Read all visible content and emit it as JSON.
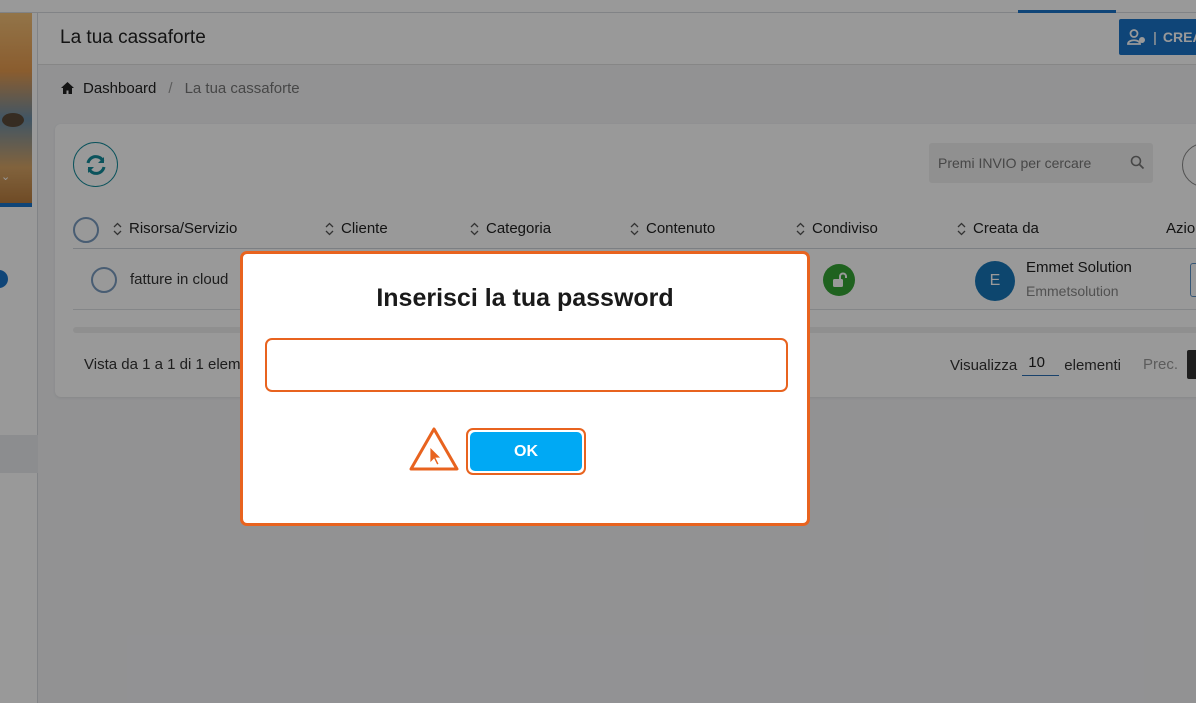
{
  "header": {
    "title": "La tua cassaforte",
    "create_button_label": "CREA"
  },
  "breadcrumb": {
    "home_label": "Dashboard",
    "current_label": "La tua cassaforte"
  },
  "search": {
    "placeholder": "Premi INVIO per cercare"
  },
  "table": {
    "columns": [
      "Risorsa/Servizio",
      "Cliente",
      "Categoria",
      "Contenuto",
      "Condiviso",
      "Creata da",
      "Azio"
    ],
    "rows": [
      {
        "resource": "fatture in cloud",
        "shared": true,
        "creator_initial": "E",
        "creator_name": "Emmet Solution",
        "creator_username": "Emmetsolution"
      }
    ]
  },
  "footer": {
    "info": "Vista da 1 a 1 di 1 elem",
    "show_label": "Visualizza",
    "page_size": "10",
    "elements_label": "elementi",
    "prev_label": "Prec."
  },
  "modal": {
    "title": "Inserisci la tua password",
    "password_value": "",
    "ok_label": "OK"
  },
  "colors": {
    "primary": "#1a73c9",
    "highlight": "#e8631f",
    "ok_button": "#00a9f4",
    "shared_badge": "#35a335",
    "avatar": "#1676b7"
  },
  "icons": {
    "home": "home-icon",
    "refresh": "refresh-icon",
    "search": "search-icon",
    "sort": "sort-icon",
    "unlock": "unlock-icon",
    "warning": "warning-icon",
    "add_user": "add-user-icon"
  }
}
